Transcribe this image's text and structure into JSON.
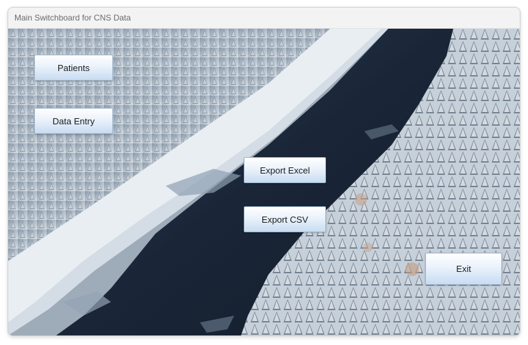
{
  "window": {
    "title": "Main Switchboard for CNS Data"
  },
  "buttons": {
    "patients": "Patients",
    "data_entry": "Data Entry",
    "export_excel": "Export Excel",
    "export_csv": "Export CSV",
    "exit": "Exit"
  },
  "background": {
    "subject": "winter-river-forest-photo"
  }
}
